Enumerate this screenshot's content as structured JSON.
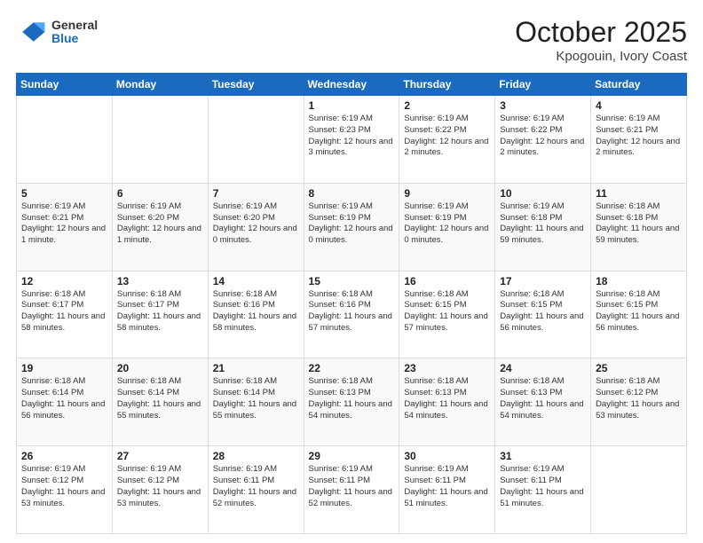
{
  "header": {
    "logo_general": "General",
    "logo_blue": "Blue",
    "title": "October 2025",
    "subtitle": "Kpogouin, Ivory Coast"
  },
  "weekdays": [
    "Sunday",
    "Monday",
    "Tuesday",
    "Wednesday",
    "Thursday",
    "Friday",
    "Saturday"
  ],
  "weeks": [
    [
      {
        "day": "",
        "info": ""
      },
      {
        "day": "",
        "info": ""
      },
      {
        "day": "",
        "info": ""
      },
      {
        "day": "1",
        "info": "Sunrise: 6:19 AM\nSunset: 6:23 PM\nDaylight: 12 hours and 3 minutes."
      },
      {
        "day": "2",
        "info": "Sunrise: 6:19 AM\nSunset: 6:22 PM\nDaylight: 12 hours and 2 minutes."
      },
      {
        "day": "3",
        "info": "Sunrise: 6:19 AM\nSunset: 6:22 PM\nDaylight: 12 hours and 2 minutes."
      },
      {
        "day": "4",
        "info": "Sunrise: 6:19 AM\nSunset: 6:21 PM\nDaylight: 12 hours and 2 minutes."
      }
    ],
    [
      {
        "day": "5",
        "info": "Sunrise: 6:19 AM\nSunset: 6:21 PM\nDaylight: 12 hours and 1 minute."
      },
      {
        "day": "6",
        "info": "Sunrise: 6:19 AM\nSunset: 6:20 PM\nDaylight: 12 hours and 1 minute."
      },
      {
        "day": "7",
        "info": "Sunrise: 6:19 AM\nSunset: 6:20 PM\nDaylight: 12 hours and 0 minutes."
      },
      {
        "day": "8",
        "info": "Sunrise: 6:19 AM\nSunset: 6:19 PM\nDaylight: 12 hours and 0 minutes."
      },
      {
        "day": "9",
        "info": "Sunrise: 6:19 AM\nSunset: 6:19 PM\nDaylight: 12 hours and 0 minutes."
      },
      {
        "day": "10",
        "info": "Sunrise: 6:19 AM\nSunset: 6:18 PM\nDaylight: 11 hours and 59 minutes."
      },
      {
        "day": "11",
        "info": "Sunrise: 6:18 AM\nSunset: 6:18 PM\nDaylight: 11 hours and 59 minutes."
      }
    ],
    [
      {
        "day": "12",
        "info": "Sunrise: 6:18 AM\nSunset: 6:17 PM\nDaylight: 11 hours and 58 minutes."
      },
      {
        "day": "13",
        "info": "Sunrise: 6:18 AM\nSunset: 6:17 PM\nDaylight: 11 hours and 58 minutes."
      },
      {
        "day": "14",
        "info": "Sunrise: 6:18 AM\nSunset: 6:16 PM\nDaylight: 11 hours and 58 minutes."
      },
      {
        "day": "15",
        "info": "Sunrise: 6:18 AM\nSunset: 6:16 PM\nDaylight: 11 hours and 57 minutes."
      },
      {
        "day": "16",
        "info": "Sunrise: 6:18 AM\nSunset: 6:15 PM\nDaylight: 11 hours and 57 minutes."
      },
      {
        "day": "17",
        "info": "Sunrise: 6:18 AM\nSunset: 6:15 PM\nDaylight: 11 hours and 56 minutes."
      },
      {
        "day": "18",
        "info": "Sunrise: 6:18 AM\nSunset: 6:15 PM\nDaylight: 11 hours and 56 minutes."
      }
    ],
    [
      {
        "day": "19",
        "info": "Sunrise: 6:18 AM\nSunset: 6:14 PM\nDaylight: 11 hours and 56 minutes."
      },
      {
        "day": "20",
        "info": "Sunrise: 6:18 AM\nSunset: 6:14 PM\nDaylight: 11 hours and 55 minutes."
      },
      {
        "day": "21",
        "info": "Sunrise: 6:18 AM\nSunset: 6:14 PM\nDaylight: 11 hours and 55 minutes."
      },
      {
        "day": "22",
        "info": "Sunrise: 6:18 AM\nSunset: 6:13 PM\nDaylight: 11 hours and 54 minutes."
      },
      {
        "day": "23",
        "info": "Sunrise: 6:18 AM\nSunset: 6:13 PM\nDaylight: 11 hours and 54 minutes."
      },
      {
        "day": "24",
        "info": "Sunrise: 6:18 AM\nSunset: 6:13 PM\nDaylight: 11 hours and 54 minutes."
      },
      {
        "day": "25",
        "info": "Sunrise: 6:18 AM\nSunset: 6:12 PM\nDaylight: 11 hours and 53 minutes."
      }
    ],
    [
      {
        "day": "26",
        "info": "Sunrise: 6:19 AM\nSunset: 6:12 PM\nDaylight: 11 hours and 53 minutes."
      },
      {
        "day": "27",
        "info": "Sunrise: 6:19 AM\nSunset: 6:12 PM\nDaylight: 11 hours and 53 minutes."
      },
      {
        "day": "28",
        "info": "Sunrise: 6:19 AM\nSunset: 6:11 PM\nDaylight: 11 hours and 52 minutes."
      },
      {
        "day": "29",
        "info": "Sunrise: 6:19 AM\nSunset: 6:11 PM\nDaylight: 11 hours and 52 minutes."
      },
      {
        "day": "30",
        "info": "Sunrise: 6:19 AM\nSunset: 6:11 PM\nDaylight: 11 hours and 51 minutes."
      },
      {
        "day": "31",
        "info": "Sunrise: 6:19 AM\nSunset: 6:11 PM\nDaylight: 11 hours and 51 minutes."
      },
      {
        "day": "",
        "info": ""
      }
    ]
  ]
}
